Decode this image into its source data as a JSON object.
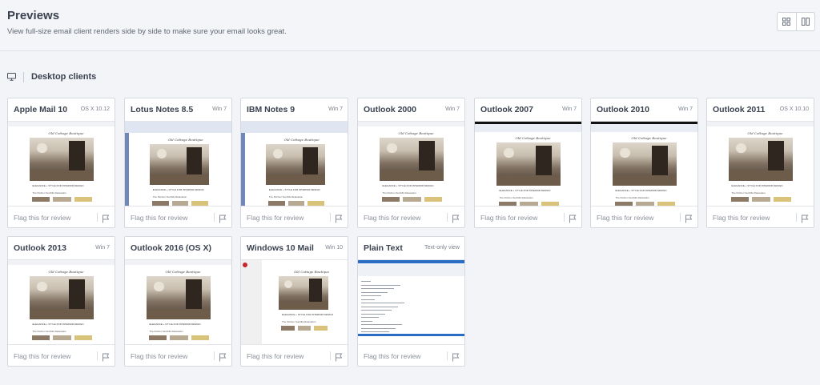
{
  "header": {
    "title": "Previews",
    "subtitle": "View full-size email client renders side by side to make sure your email looks great."
  },
  "view_toggle": {
    "options": [
      "grid-view-icon",
      "split-view-icon"
    ]
  },
  "section": {
    "icon": "monitor-icon",
    "title": "Desktop clients"
  },
  "flag_label": "Flag this for review",
  "thumbnail": {
    "script_title": "Old Cottage Boutique",
    "caption": "ELEGANCE  +  STYLE FOR INTERIOR DESIGN",
    "links": [
      "The Kitchen",
      "Sunhills",
      "Relaxation"
    ]
  },
  "clients": [
    {
      "name": "Apple Mail 10",
      "platform": "OS X 10.12",
      "chrome": "light"
    },
    {
      "name": "Lotus Notes 8.5",
      "platform": "Win 7",
      "chrome": "lotus"
    },
    {
      "name": "IBM Notes 9",
      "platform": "Win 7",
      "chrome": "lotus"
    },
    {
      "name": "Outlook 2000",
      "platform": "Win 7",
      "chrome": "light"
    },
    {
      "name": "Outlook 2007",
      "platform": "Win 7",
      "chrome": "dark"
    },
    {
      "name": "Outlook 2010",
      "platform": "Win 7",
      "chrome": "dark"
    },
    {
      "name": "Outlook 2011",
      "platform": "OS X 10.10",
      "chrome": "light"
    },
    {
      "name": "Outlook 2013",
      "platform": "Win 7",
      "chrome": "light"
    },
    {
      "name": "Outlook 2016 (OS X)",
      "platform": "",
      "chrome": "light"
    },
    {
      "name": "Windows 10 Mail",
      "platform": "Win 10",
      "chrome": "win10"
    },
    {
      "name": "Plain Text",
      "platform": "Text-only view",
      "chrome": "plain"
    }
  ],
  "colors": {
    "background": "#f3f4f8",
    "card_border": "#d5d8de",
    "title_text": "#3a4250",
    "muted_text": "#8a909a",
    "accent_blue": "#2b6cc4"
  }
}
